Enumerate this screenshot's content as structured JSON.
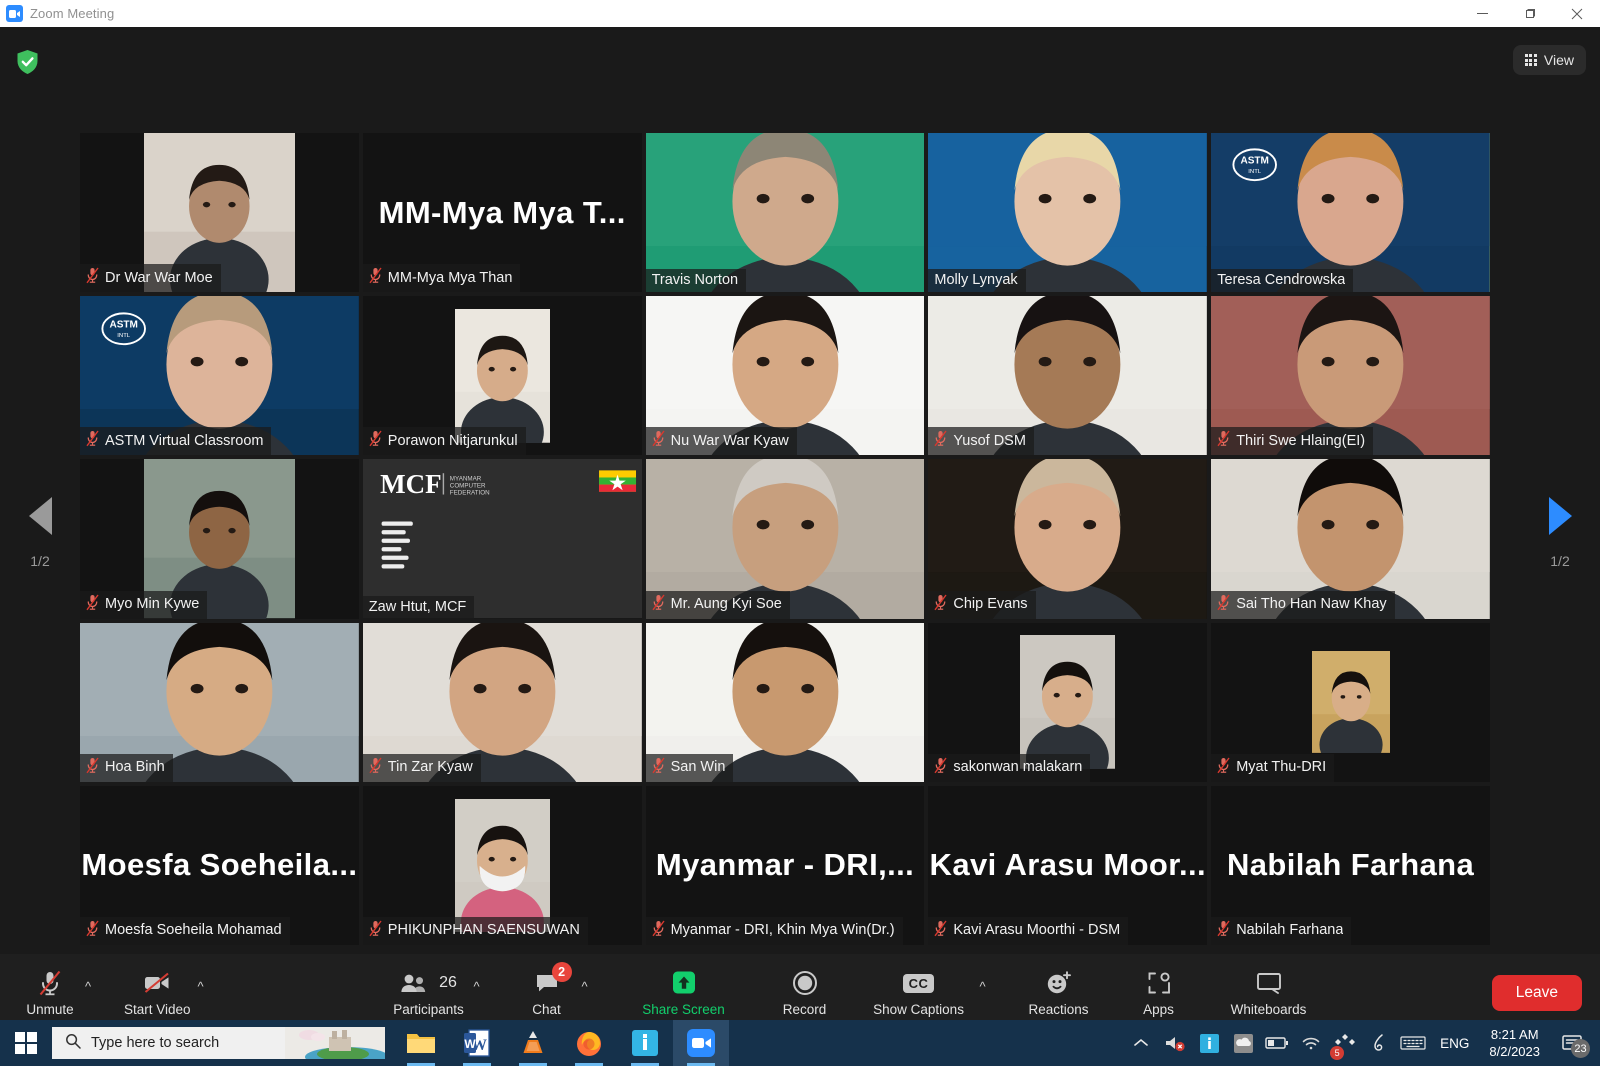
{
  "window": {
    "title": "Zoom Meeting",
    "app_icon": "zoom-video-icon",
    "minimize": "minimize-icon",
    "restore": "restore-icon",
    "close": "close-icon"
  },
  "topbar": {
    "encryption_badge": "shield-check-icon",
    "view_label": "View",
    "view_icon": "grid-icon"
  },
  "pager": {
    "prev_label": "1/2",
    "next_label": "1/2",
    "prev_icon": "chevron-left-icon",
    "next_icon": "chevron-right-icon"
  },
  "colors": {
    "active_speaker_border": "#d6e94a",
    "share_screen_green": "#12cf6c",
    "leave_red": "#e02d2d",
    "badge_red": "#e8453c",
    "taskbar_blue": "#15314b"
  },
  "participants": [
    {
      "name": "Dr War War Moe",
      "muted": true,
      "mode": "portrait",
      "bg": "#cfc6bd",
      "skin": "#b08a6e",
      "hair": "#231a15",
      "wall": "#e4ded6"
    },
    {
      "name": "MM-Mya Mya Than",
      "muted": true,
      "mode": "name",
      "display": "MM-Mya Mya T..."
    },
    {
      "name": "Travis Norton",
      "muted": false,
      "mode": "full",
      "bg": "#1f9c74",
      "skin": "#cfa98c",
      "hair": "#8d8676",
      "wall": "#2fa87f"
    },
    {
      "name": "Molly Lynyak",
      "muted": false,
      "mode": "full",
      "bg": "#17639f",
      "skin": "#e4c2a8",
      "hair": "#e8d7a8",
      "wall": "#17639f"
    },
    {
      "name": "Teresa Cendrowska",
      "muted": false,
      "mode": "full",
      "bg": "#123a63",
      "skin": "#d9a78e",
      "hair": "#c98b4a",
      "wall": "#153f6b",
      "active": true,
      "logo": "ASTM"
    },
    {
      "name": "ASTM Virtual Classroom",
      "muted": true,
      "mode": "full",
      "bg": "#0c3558",
      "skin": "#ddb49a",
      "hair": "#b79b7c",
      "wall": "#0f4070",
      "logo": "ASTM"
    },
    {
      "name": "Porawon Nitjarunkul",
      "muted": true,
      "mode": "small",
      "bg": "#e6e2da",
      "skin": "#d6ac8a",
      "hair": "#1d1713",
      "wall": "#efebe3"
    },
    {
      "name": "Nu War War Kyaw",
      "muted": true,
      "mode": "full",
      "bg": "#f4f4f2",
      "skin": "#d5a884",
      "hair": "#1b1512",
      "wall": "#f8f8f6"
    },
    {
      "name": "Yusof DSM",
      "muted": true,
      "mode": "full",
      "bg": "#e9e7e2",
      "skin": "#a57a56",
      "hair": "#171212",
      "wall": "#efeeea"
    },
    {
      "name": "Thiri Swe Hlaing(EI)",
      "muted": true,
      "mode": "full",
      "bg": "#9e5a52",
      "skin": "#c99a78",
      "hair": "#1c1513",
      "wall": "#a5655c"
    },
    {
      "name": "Myo Min Kywe",
      "muted": true,
      "mode": "portrait",
      "bg": "#7e8e84",
      "skin": "#8e6544",
      "hair": "#140f0d",
      "wall": "#93a096"
    },
    {
      "name": "Zaw Htut, MCF",
      "muted": false,
      "mode": "slide",
      "bg": "#2b2b2b",
      "slide_title": "MCF",
      "slide_sub": "MYANMAR COMPUTER FEDERATION"
    },
    {
      "name": "Mr. Aung Kyi Soe",
      "muted": true,
      "mode": "full",
      "bg": "#b2aba1",
      "skin": "#c79f7e",
      "hair": "#cfcac3",
      "wall": "#bdb6ac"
    },
    {
      "name": "Chip Evans",
      "muted": true,
      "mode": "full",
      "bg": "#1d1913",
      "skin": "#d8ab8b",
      "hair": "#cbb79c",
      "wall": "#241e17"
    },
    {
      "name": "Sai Tho Han Naw Khay",
      "muted": true,
      "mode": "full",
      "bg": "#d9d6cf",
      "skin": "#c3946e",
      "hair": "#100c0a",
      "wall": "#e0ddd6"
    },
    {
      "name": "Hoa Binh",
      "muted": true,
      "mode": "full",
      "bg": "#9aa7ae",
      "skin": "#d6ab84",
      "hair": "#120e0c",
      "wall": "#aab5ba"
    },
    {
      "name": "Tin Zar Kyaw",
      "muted": true,
      "mode": "full",
      "bg": "#ded9d2",
      "skin": "#d2a582",
      "hair": "#1a1411",
      "wall": "#e4e0da"
    },
    {
      "name": "San Win",
      "muted": true,
      "mode": "full",
      "bg": "#f0efec",
      "skin": "#c8996f",
      "hair": "#15100d",
      "wall": "#f6f5f2"
    },
    {
      "name": "sakonwan malakarn",
      "muted": true,
      "mode": "small",
      "bg": "#c7c3bc",
      "skin": "#d7ae8b",
      "hair": "#14100d",
      "wall": "#cfccc5"
    },
    {
      "name": "Myat Thu-DRI",
      "muted": true,
      "mode": "tiny",
      "bg": "#c8a35e",
      "skin": "#d8ae88",
      "hair": "#15100d",
      "wall": "#d7b877"
    },
    {
      "name": "Moesfa Soeheila Mohamad",
      "muted": true,
      "mode": "name",
      "display": "Moesfa Soeheila..."
    },
    {
      "name": "PHIKUNPHAN SAENSUWAN",
      "muted": true,
      "mode": "small",
      "bg": "#cfcac2",
      "skin": "#d8b08d",
      "hair": "#17120f",
      "wall": "#d6d2ca",
      "mask": true
    },
    {
      "name": "Myanmar - DRI, Khin Mya Win(Dr.)",
      "muted": true,
      "mode": "name",
      "display": "Myanmar - DRI,..."
    },
    {
      "name": "Kavi Arasu Moorthi - DSM",
      "muted": true,
      "mode": "name",
      "display": "Kavi Arasu Moor..."
    },
    {
      "name": "Nabilah Farhana",
      "muted": true,
      "mode": "name",
      "display": "Nabilah Farhana"
    }
  ],
  "toolbar": {
    "unmute": {
      "label": "Unmute",
      "icon": "mic-muted-icon",
      "has_caret": true
    },
    "start_video": {
      "label": "Start Video",
      "icon": "video-muted-icon",
      "has_caret": true
    },
    "participants": {
      "label": "Participants",
      "icon": "people-icon",
      "count": "26",
      "has_caret": true
    },
    "chat": {
      "label": "Chat",
      "icon": "chat-bubble-icon",
      "badge": "2",
      "has_caret": true
    },
    "share_screen": {
      "label": "Share Screen",
      "icon": "share-arrow-up-icon",
      "has_caret": false
    },
    "record": {
      "label": "Record",
      "icon": "record-circle-icon",
      "has_caret": false
    },
    "show_captions": {
      "label": "Show Captions",
      "icon": "cc-icon",
      "has_caret": true
    },
    "reactions": {
      "label": "Reactions",
      "icon": "smiley-plus-icon",
      "has_caret": false
    },
    "apps": {
      "label": "Apps",
      "icon": "apps-icon",
      "has_caret": false
    },
    "whiteboards": {
      "label": "Whiteboards",
      "icon": "whiteboard-icon",
      "has_caret": false
    },
    "leave": {
      "label": "Leave"
    }
  },
  "taskbar": {
    "start_icon": "windows-start-icon",
    "search_placeholder": "Type here to search",
    "search_icon": "magnifier-icon",
    "apps": [
      {
        "name": "file-explorer-icon"
      },
      {
        "name": "word-icon"
      },
      {
        "name": "vlc-icon"
      },
      {
        "name": "firefox-icon"
      },
      {
        "name": "info-app-icon"
      },
      {
        "name": "zoom-app-icon",
        "active": true
      }
    ],
    "tray": [
      {
        "name": "show-hidden-icons-chevron"
      },
      {
        "name": "audio-muted-icon"
      },
      {
        "name": "info-tray-icon"
      },
      {
        "name": "onedrive-icon"
      },
      {
        "name": "battery-icon"
      },
      {
        "name": "wifi-icon"
      },
      {
        "name": "updates-icon",
        "badge": "5"
      },
      {
        "name": "pen-icon"
      },
      {
        "name": "touch-keyboard-icon"
      }
    ],
    "language": "ENG",
    "time": "8:21 AM",
    "date": "8/2/2023",
    "notification_icon": "notification-icon",
    "notification_count": "23"
  }
}
